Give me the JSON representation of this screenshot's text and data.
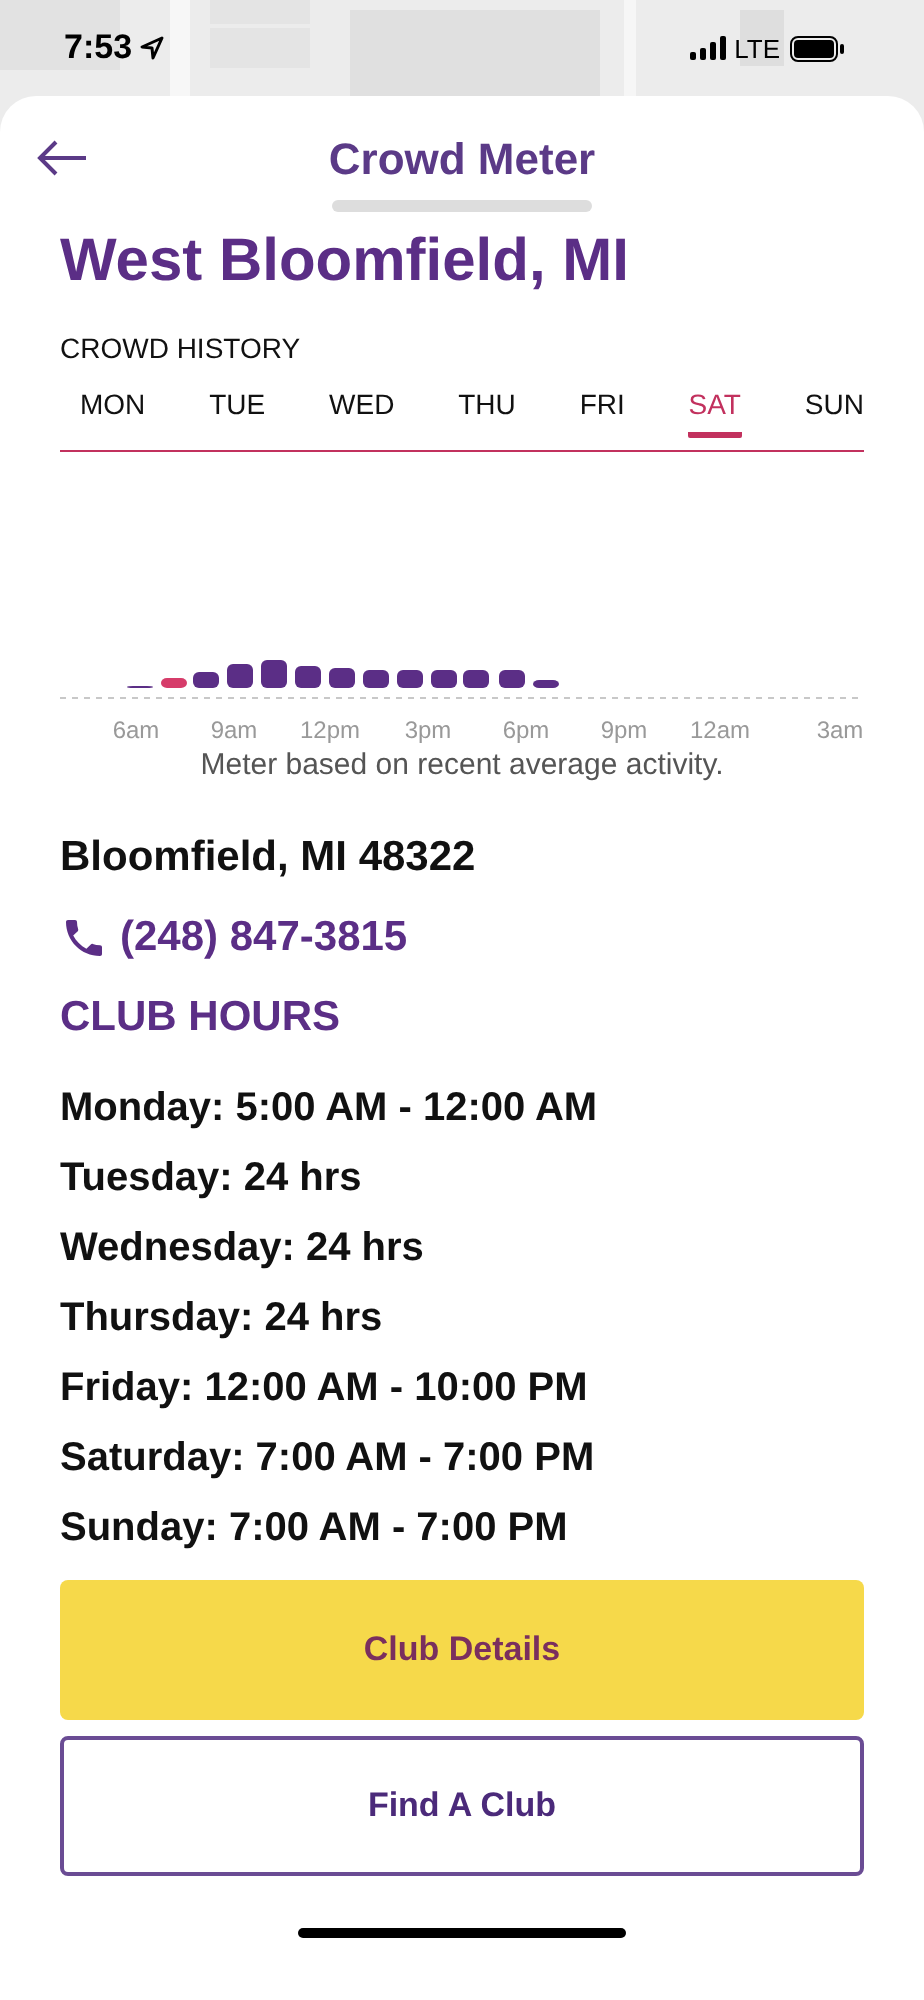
{
  "status_bar": {
    "time": "7:53",
    "network": "LTE"
  },
  "header": {
    "title": "Crowd Meter"
  },
  "club": {
    "name": "West Bloomfield, MI"
  },
  "crowd_history": {
    "label": "CROWD HISTORY",
    "days": [
      {
        "label": "MON",
        "selected": false
      },
      {
        "label": "TUE",
        "selected": false
      },
      {
        "label": "WED",
        "selected": false
      },
      {
        "label": "THU",
        "selected": false
      },
      {
        "label": "FRI",
        "selected": false
      },
      {
        "label": "SAT",
        "selected": true
      },
      {
        "label": "SUN",
        "selected": false
      }
    ],
    "hour_labels": [
      "6am",
      "9am",
      "12pm",
      "3pm",
      "6pm",
      "9pm",
      "12am",
      "3am"
    ],
    "note": "Meter based on recent average activity."
  },
  "address_line": "Bloomfield, MI 48322",
  "phone": "(248) 847-3815",
  "hours": {
    "title": "CLUB HOURS",
    "rows": [
      "Monday: 5:00 AM - 12:00 AM",
      "Tuesday: 24 hrs",
      "Wednesday: 24 hrs",
      "Thursday: 24 hrs",
      "Friday: 12:00 AM - 10:00 PM",
      "Saturday: 7:00 AM - 7:00 PM",
      "Sunday: 7:00 AM - 7:00 PM"
    ]
  },
  "buttons": [
    {
      "label": "Club Details",
      "kind": "primary"
    },
    {
      "label": "Find A Club",
      "kind": "outline"
    }
  ]
}
